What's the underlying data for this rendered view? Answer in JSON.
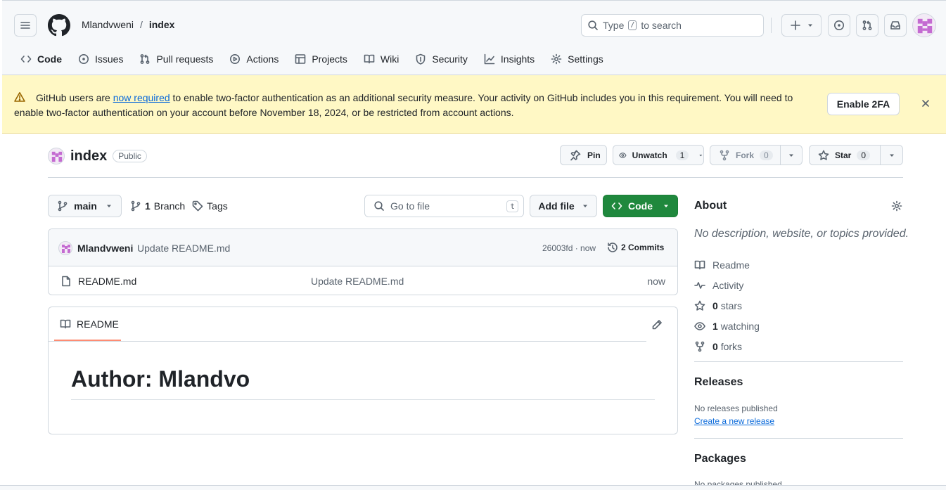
{
  "header": {
    "owner": "Mlandvweni",
    "separator": "/",
    "repo": "index",
    "search_prefix": "Type",
    "search_key": "/",
    "search_suffix": "to search"
  },
  "tabs": [
    {
      "label": "Code",
      "icon": "code-icon"
    },
    {
      "label": "Issues",
      "icon": "issue-icon"
    },
    {
      "label": "Pull requests",
      "icon": "pull-request-icon"
    },
    {
      "label": "Actions",
      "icon": "play-icon"
    },
    {
      "label": "Projects",
      "icon": "table-icon"
    },
    {
      "label": "Wiki",
      "icon": "book-icon"
    },
    {
      "label": "Security",
      "icon": "shield-icon"
    },
    {
      "label": "Insights",
      "icon": "graph-icon"
    },
    {
      "label": "Settings",
      "icon": "gear-icon"
    }
  ],
  "banner": {
    "text_before": "GitHub users are ",
    "link": "now required",
    "text_after": " to enable two-factor authentication as an additional security measure. Your activity on GitHub includes you in this requirement. You will need to enable two-factor authentication on your account before November 18, 2024, or be restricted from account actions.",
    "button": "Enable 2FA"
  },
  "repo_header": {
    "name": "index",
    "visibility": "Public",
    "pin": "Pin",
    "unwatch": "Unwatch",
    "watch_count": "1",
    "fork": "Fork",
    "fork_count": "0",
    "star": "Star",
    "star_count": "0"
  },
  "toolbar": {
    "branch": "main",
    "branch_count": "1",
    "branch_label": "Branch",
    "tags_label": "Tags",
    "goto_placeholder": "Go to file",
    "goto_key": "t",
    "add_file": "Add file",
    "code": "Code"
  },
  "commit": {
    "author": "Mlandvweni",
    "message": "Update README.md",
    "hash_time": "26003fd · now",
    "commits": "2 Commits"
  },
  "files": [
    {
      "name": "README.md",
      "message": "Update README.md",
      "time": "now"
    }
  ],
  "readme": {
    "tab": "README",
    "heading": "Author: Mlandvo"
  },
  "sidebar": {
    "about": "About",
    "description": "No description, website, or topics provided.",
    "items": [
      {
        "icon": "book-icon",
        "strong": "",
        "label": "Readme"
      },
      {
        "icon": "pulse-icon",
        "strong": "",
        "label": "Activity"
      },
      {
        "icon": "star-icon",
        "strong": "0",
        "label": "stars"
      },
      {
        "icon": "eye-icon",
        "strong": "1",
        "label": "watching"
      },
      {
        "icon": "fork-icon",
        "strong": "0",
        "label": "forks"
      }
    ],
    "releases": "Releases",
    "no_releases": "No releases published",
    "create_release": "Create a new release",
    "packages": "Packages",
    "no_packages": "No packages published"
  }
}
